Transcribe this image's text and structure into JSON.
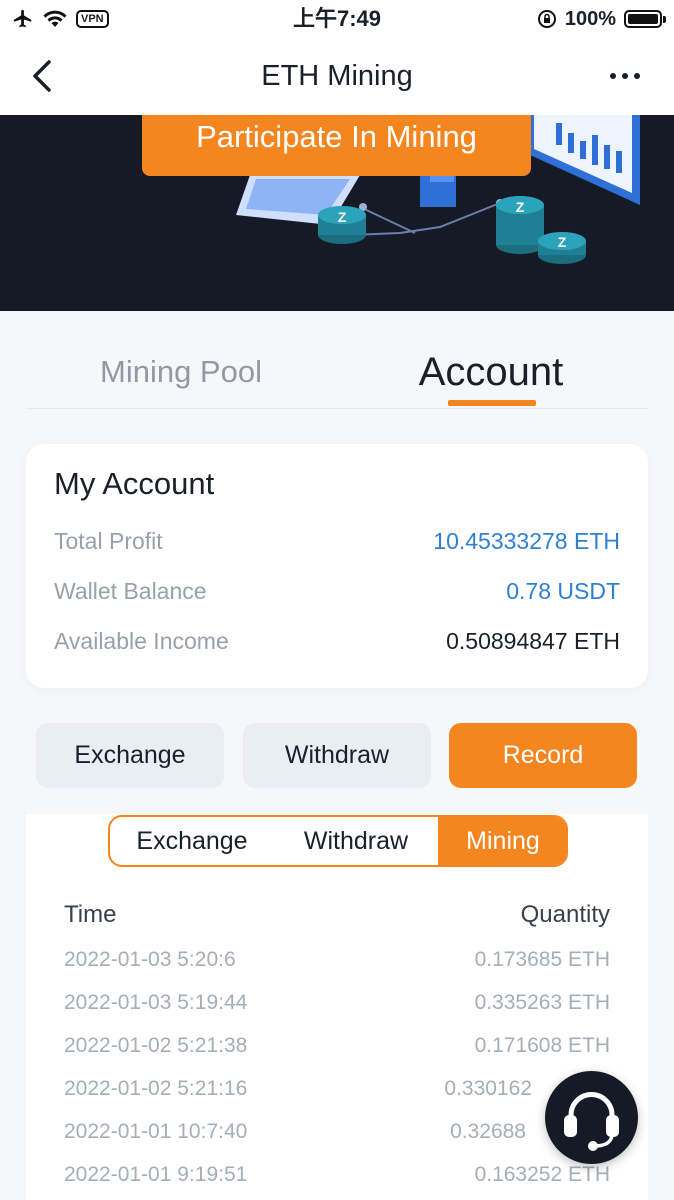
{
  "status_bar": {
    "vpn_label": "VPN",
    "time": "上午7:49",
    "battery": "100%",
    "battery_level": 1.0
  },
  "nav": {
    "title": "ETH Mining",
    "back_icon": "chevron-left-icon",
    "more_icon": "more-dots-icon"
  },
  "banner": {
    "button_label": "Participate In Mining",
    "coin_glyph": "Z"
  },
  "tabs": [
    {
      "label": "Mining Pool",
      "active": false
    },
    {
      "label": "Account",
      "active": true
    }
  ],
  "account": {
    "title": "My Account",
    "rows": [
      {
        "label": "Total Profit",
        "value": "10.45333278 ETH"
      },
      {
        "label": "Wallet Balance",
        "value": "0.78 USDT"
      },
      {
        "label": "Available Income",
        "value": "0.50894847 ETH"
      }
    ]
  },
  "actions": [
    {
      "label": "Exchange",
      "active": false
    },
    {
      "label": "Withdraw",
      "active": false
    },
    {
      "label": "Record",
      "active": true
    }
  ],
  "record_tabs": [
    {
      "label": "Exchange",
      "active": false
    },
    {
      "label": "Withdraw",
      "active": false
    },
    {
      "label": "Mining",
      "active": true
    }
  ],
  "records": {
    "headers": {
      "time": "Time",
      "quantity": "Quantity"
    },
    "rows": [
      {
        "time": "2022-01-03 5:20:6",
        "quantity": "0.173685 ETH"
      },
      {
        "time": "2022-01-03 5:19:44",
        "quantity": "0.335263 ETH"
      },
      {
        "time": "2022-01-02 5:21:38",
        "quantity": "0.171608 ETH"
      },
      {
        "time": "2022-01-02 5:21:16",
        "quantity": "0.330162"
      },
      {
        "time": "2022-01-01 10:7:40",
        "quantity": "0.32688"
      },
      {
        "time": "2022-01-01 9:19:51",
        "quantity": "0.163252 ETH"
      }
    ]
  },
  "support": {
    "icon": "headset-icon"
  },
  "colors": {
    "accent": "#f5861f",
    "link_blue": "#2f7fd4",
    "banner_bg": "#161a27",
    "muted": "#9aa0ab"
  }
}
